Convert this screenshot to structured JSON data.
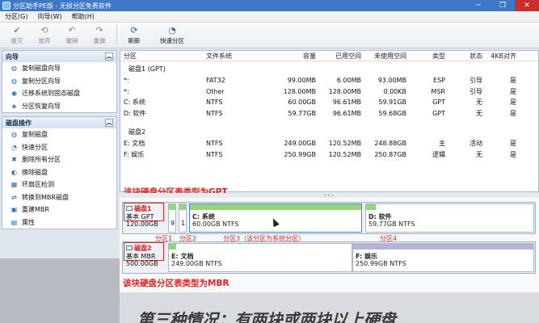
{
  "window": {
    "title": "分区助手PE版 - 无损分区免费软件",
    "minimize": "─",
    "restore": "❐",
    "close": "✕"
  },
  "menu": [
    "分区(G)",
    "向导(W)",
    "帮助(H)"
  ],
  "toolbar": {
    "items": [
      {
        "label": "提交",
        "icon": "commit-icon",
        "glyph": "✔",
        "enabled": false
      },
      {
        "label": "放弃",
        "icon": "discard-icon",
        "glyph": "⟲",
        "enabled": false
      },
      {
        "label": "撤销",
        "icon": "undo-icon",
        "glyph": "↶",
        "enabled": false
      },
      {
        "label": "重做",
        "icon": "redo-icon",
        "glyph": "↷",
        "enabled": false
      },
      {
        "label": "刷新",
        "icon": "refresh-icon",
        "glyph": "⟳",
        "enabled": true
      },
      {
        "label": "快速分区",
        "icon": "quick-partition-icon",
        "glyph": "◔",
        "enabled": true
      }
    ]
  },
  "sidebar": {
    "wizard": {
      "title": "向导",
      "items": [
        "复制磁盘向导",
        "复制分区向导",
        "迁移系统到固态磁盘",
        "分区恢复向导"
      ]
    },
    "disk_ops": {
      "title": "磁盘操作",
      "items": [
        "复制磁盘",
        "快速分区",
        "删除所有分区",
        "擦除磁盘",
        "坏扇区检测",
        "转换到MBR磁盘",
        "重建MBR",
        "属性"
      ]
    },
    "collapse_glyph": "︽"
  },
  "table": {
    "headers": {
      "name": "分区",
      "fs": "文件系统",
      "capacity": "容量",
      "used": "已用空间",
      "free": "未使用空间",
      "type": "类型",
      "status": "状态",
      "align": "4KB对齐"
    },
    "disk1": {
      "label": "磁盘1 (GPT)",
      "rows": [
        {
          "name": "*:",
          "fs": "FAT32",
          "capacity": "99.00MB",
          "used": "6.00MB",
          "free": "93.00MB",
          "type": "ESP",
          "status": "引导",
          "align": "是"
        },
        {
          "name": "*:",
          "fs": "Other",
          "capacity": "128.00MB",
          "used": "128.00MB",
          "free": "0.00KB",
          "type": "MSR",
          "status": "引导",
          "align": "是"
        },
        {
          "name": "C: 系统",
          "fs": "NTFS",
          "capacity": "60.00GB",
          "used": "96.61MB",
          "free": "59.91GB",
          "type": "GPT",
          "status": "无",
          "align": "是"
        },
        {
          "name": "D: 软件",
          "fs": "NTFS",
          "capacity": "59.77GB",
          "used": "96.61MB",
          "free": "59.68GB",
          "type": "GPT",
          "status": "无",
          "align": "是"
        }
      ]
    },
    "disk2": {
      "label": "磁盘2",
      "rows": [
        {
          "name": "E: 文档",
          "fs": "NTFS",
          "capacity": "249.00GB",
          "used": "120.52MB",
          "free": "248.88GB",
          "type": "主",
          "status": "活动",
          "align": "是"
        },
        {
          "name": "F: 娱乐",
          "fs": "NTFS",
          "capacity": "250.99GB",
          "used": "120.52MB",
          "free": "250.87GB",
          "type": "逻辑",
          "status": "无",
          "align": "是"
        }
      ]
    }
  },
  "annotations": {
    "gpt_note": "该块硬盘分区表类型为GPT",
    "mbr_note": "该块硬盘分区表类型为MBR",
    "p1": "分区1",
    "p2": "分区2",
    "p3": "分区3（该分区为系统分区）",
    "p4": "分区4"
  },
  "diskmap": {
    "disk1": {
      "name": "磁盘1",
      "scheme": "基本 GPT",
      "size": "120.00GB",
      "small1": "9",
      "small2": "1",
      "c_label": "C: 系统",
      "c_size": "60.00GB NTFS",
      "d_label": "D: 软件",
      "d_size": "59.77GB NTFS"
    },
    "disk2": {
      "name": "磁盘2",
      "scheme": "基本 MBR",
      "size": "500.00GB",
      "e_label": "E: 文档",
      "e_size": "249.00GB NTFS",
      "f_label": "F: 娱乐",
      "f_size": "250.99GB NTFS"
    }
  },
  "bottom_caption": "第三种情况：有两块或两块以上硬盘",
  "colors": {
    "accent": "#3f78c8",
    "annotation_red": "#e8231f",
    "used_green": "#96d67a",
    "logical_purple": "#b6b2dc"
  }
}
